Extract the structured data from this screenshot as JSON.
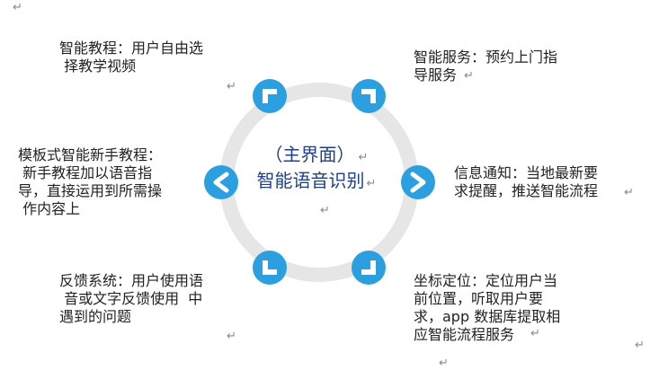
{
  "diagram": {
    "center_line1": "（主界面）",
    "center_line2": "智能语音识别",
    "paragraph_mark": "↵",
    "ring_color": "#e6e6e6",
    "button_color": "#2b9fe0",
    "arrow_color": "#ffffff",
    "center_text_color": "#1f3f8f",
    "nodes": [
      {
        "text": "智能教程：用户自由选\n 择教学视频"
      },
      {
        "text": "智能服务：预约上门指\n导服务"
      },
      {
        "text": "模板式智能新手教程：\n 新手教程加以语音指\n导，直接运用到所需操\n 作内容上"
      },
      {
        "text": "信息通知：当地最新要\n求提醒，推送智能流程"
      },
      {
        "text": "反馈系统：用户使用语\n 音或文字反馈使用  中\n遇到的问题"
      },
      {
        "text": "坐标定位：定位用户当\n前位置，听取用户要\n求，app 数据库提取相\n应智能流程服务"
      }
    ]
  }
}
